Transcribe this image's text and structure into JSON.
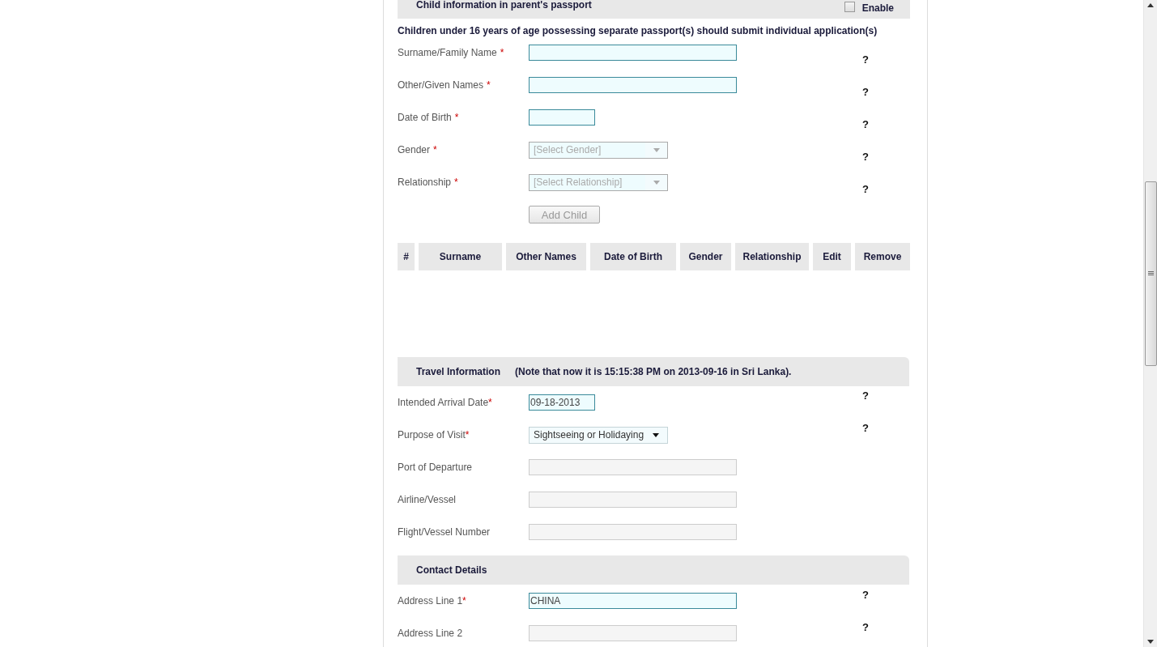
{
  "child_section": {
    "title": "Child information in parent's passport",
    "enable": {
      "label": "Enable",
      "checked": false
    },
    "note": "Children under 16 years of age possessing separate passport(s) should submit individual application(s)",
    "fields": [
      {
        "label": "Surname/Family Name",
        "marker": "*",
        "kind": "text",
        "required": true,
        "help": "?"
      },
      {
        "label": "Other/Given Names",
        "marker": "*",
        "kind": "text",
        "required": true,
        "help": "?"
      },
      {
        "label": "Date of Birth",
        "marker": "*",
        "kind": "date",
        "required": true,
        "help": "?"
      },
      {
        "label": "Gender",
        "marker": "*",
        "kind": "select",
        "required": true,
        "disabled": true,
        "placeholder": "[Select Gender]",
        "help": "?"
      },
      {
        "label": "Relationship",
        "marker": "*",
        "kind": "select",
        "required": true,
        "disabled": true,
        "placeholder": "[Select Relationship]",
        "help": "?"
      }
    ],
    "add_button": {
      "label": "Add Child",
      "disabled": true
    },
    "table": {
      "columns": [
        "#",
        "Surname",
        "Other Names",
        "Date of Birth",
        "Gender",
        "Relationship",
        "Edit",
        "Remove"
      ]
    }
  },
  "travel_section": {
    "title": "Travel Information",
    "note": "(Note that now it is 15:15:38 PM on 2013-09-16 in Sri Lanka).",
    "fields": [
      {
        "label": "Intended Arrival Date",
        "marker": "*",
        "kind": "date",
        "required": true,
        "value": "09-18-2013",
        "help": "?"
      },
      {
        "label": "Purpose of Visit",
        "marker": "*",
        "kind": "select",
        "required": true,
        "disabled": false,
        "value": "Sightseeing or Holidaying",
        "help": "?"
      },
      {
        "label": "Port of Departure",
        "kind": "text",
        "required": false
      },
      {
        "label": "Airline/Vessel",
        "kind": "text",
        "required": false
      },
      {
        "label": "Flight/Vessel Number",
        "kind": "text",
        "required": false
      }
    ]
  },
  "contact_section": {
    "title": "Contact Details",
    "fields": [
      {
        "label": "Address Line 1",
        "marker": "*",
        "kind": "text",
        "required": true,
        "value": "CHINA",
        "help": "?"
      },
      {
        "label": "Address Line 2",
        "kind": "text",
        "required": false,
        "help": "?"
      }
    ]
  }
}
